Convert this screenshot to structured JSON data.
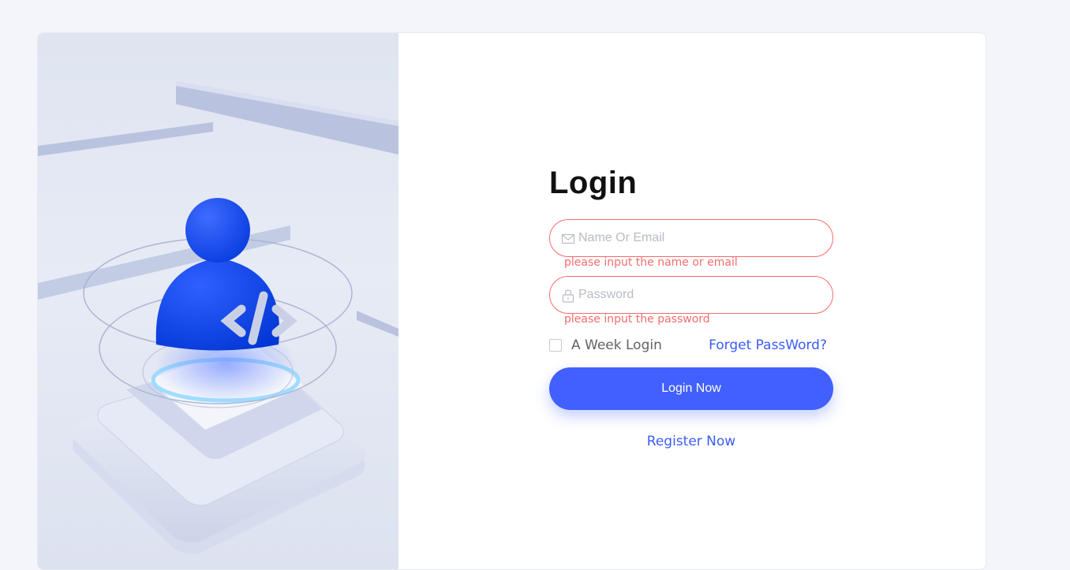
{
  "login": {
    "title": "Login",
    "name_field": {
      "placeholder": "Name Or Email",
      "value": "",
      "error": "please input the name or email"
    },
    "password_field": {
      "placeholder": "Password",
      "value": "",
      "error": "please input the password"
    },
    "remember_label": "A Week Login",
    "remember_checked": false,
    "forget_link": "Forget PassWord?",
    "submit_label": "Login Now",
    "register_link": "Register Now"
  },
  "icons": {
    "name_field": "mail-icon",
    "password_field": "lock-icon"
  },
  "colors": {
    "accent": "#4160ff",
    "link": "#3a5cf5",
    "error": "#f56c6c",
    "page_background": "#f3f5fa"
  }
}
